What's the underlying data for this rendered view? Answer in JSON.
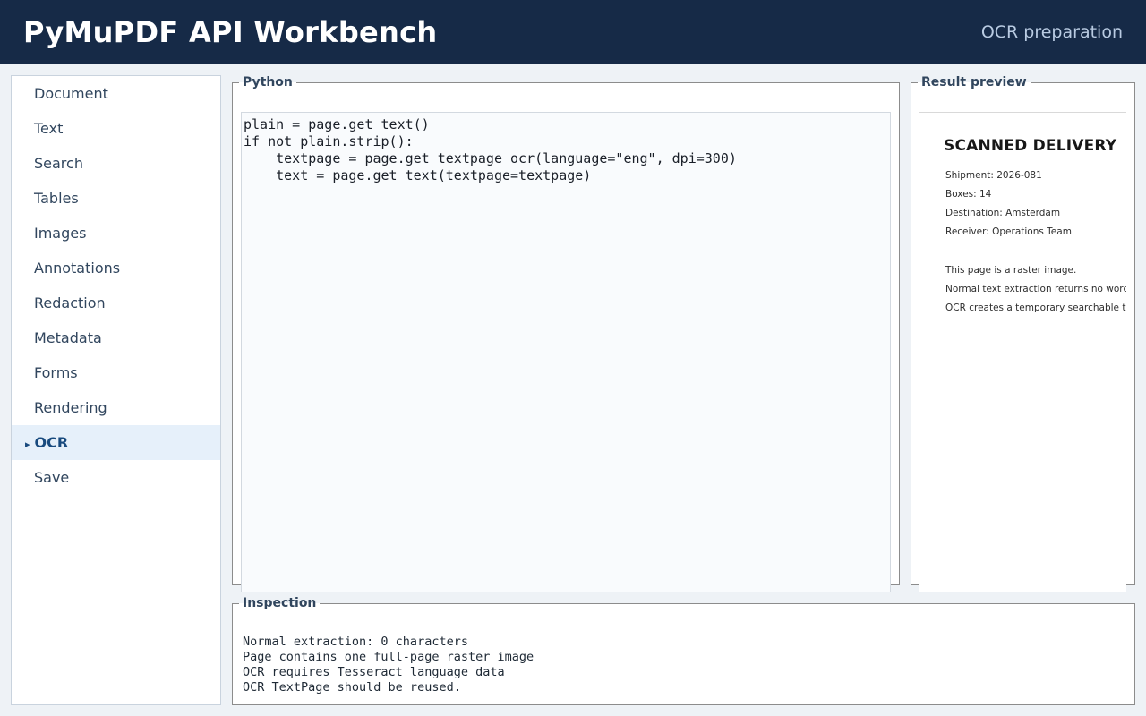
{
  "header": {
    "title": "PyMuPDF API Workbench",
    "mode": "OCR preparation"
  },
  "sidebar": {
    "items": [
      {
        "label": "Document",
        "active": false
      },
      {
        "label": "Text",
        "active": false
      },
      {
        "label": "Search",
        "active": false
      },
      {
        "label": "Tables",
        "active": false
      },
      {
        "label": "Images",
        "active": false
      },
      {
        "label": "Annotations",
        "active": false
      },
      {
        "label": "Redaction",
        "active": false
      },
      {
        "label": "Metadata",
        "active": false
      },
      {
        "label": "Forms",
        "active": false
      },
      {
        "label": "Rendering",
        "active": false
      },
      {
        "label": "OCR",
        "active": true
      },
      {
        "label": "Save",
        "active": false
      }
    ],
    "active_marker": "▸"
  },
  "python": {
    "legend": "Python",
    "code_lines": [
      "plain = page.get_text()",
      "if not plain.strip():",
      "    textpage = page.get_textpage_ocr(language=\"eng\", dpi=300)",
      "    text = page.get_text(textpage=textpage)"
    ]
  },
  "result": {
    "legend": "Result preview",
    "doc_title": "SCANNED DELIVERY",
    "doc_lines": [
      "Shipment: 2026-081",
      "Boxes: 14",
      "Destination: Amsterdam",
      "Receiver: Operations Team",
      "This page is a raster image.",
      "Normal text extraction returns no words.",
      "OCR creates a temporary searchable text layer."
    ]
  },
  "inspection": {
    "legend": "Inspection",
    "lines": [
      "Normal extraction: 0 characters",
      "Page contains one full-page raster image",
      "OCR requires Tesseract language data",
      "OCR TextPage should be reused."
    ]
  },
  "colors": {
    "header_bg": "#162a47",
    "active_nav_bg": "#e6f0fa",
    "active_nav_text": "#184a7e"
  }
}
